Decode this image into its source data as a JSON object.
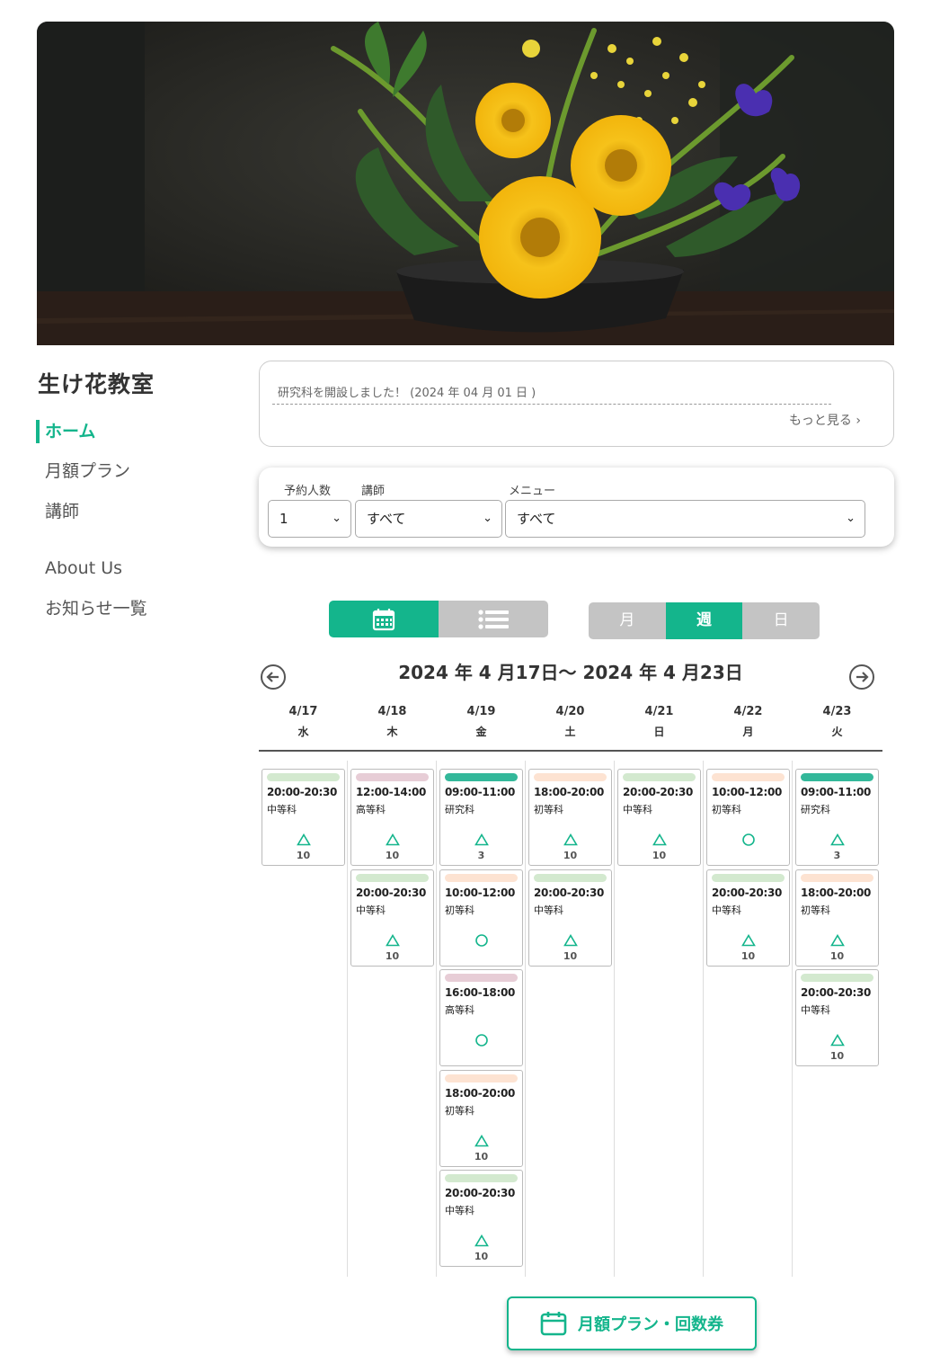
{
  "site": {
    "title": "生け花教室"
  },
  "hero": {
    "image": "ikebana-flower-arrangement"
  },
  "nav": {
    "items": [
      {
        "label": "ホーム",
        "active": true
      },
      {
        "label": "月額プラン"
      },
      {
        "label": "講師"
      },
      {
        "label": "About Us"
      },
      {
        "label": "お知らせ一覧"
      }
    ]
  },
  "news": {
    "item": "研究科を開設しました！ (2024 年 04 月 01 日 )",
    "more": "もっと見る"
  },
  "filters": {
    "people": {
      "label": "予約人数",
      "value": "1"
    },
    "teacher": {
      "label": "講師",
      "value": "すべて"
    },
    "menu": {
      "label": "メニュー",
      "value": "すべて"
    }
  },
  "view_toggle": {
    "icons": [
      "calendar-icon",
      "list-icon"
    ],
    "selected": "calendar"
  },
  "range_toggle": {
    "month": "月",
    "week": "週",
    "day": "日",
    "selected": "週"
  },
  "calendar": {
    "range": "2024 年 4 月17日〜 2024 年 4 月23日",
    "days": [
      {
        "date": "4/17",
        "weekday": "水"
      },
      {
        "date": "4/18",
        "weekday": "木"
      },
      {
        "date": "4/19",
        "weekday": "金"
      },
      {
        "date": "4/20",
        "weekday": "土"
      },
      {
        "date": "4/21",
        "weekday": "日"
      },
      {
        "date": "4/22",
        "weekday": "月"
      },
      {
        "date": "4/23",
        "weekday": "火"
      }
    ],
    "slots": [
      [
        {
          "time": "20:00-20:30",
          "menu": "中等科",
          "status": "△",
          "remaining": "10",
          "color": "#d3e9cf"
        }
      ],
      [
        {
          "time": "12:00-14:00",
          "menu": "高等科",
          "status": "△",
          "remaining": "10",
          "color": "#e7cdd6"
        },
        {
          "time": "20:00-20:30",
          "menu": "中等科",
          "status": "△",
          "remaining": "10",
          "color": "#d3e9cf"
        }
      ],
      [
        {
          "time": "09:00-11:00",
          "menu": "研究科",
          "status": "△",
          "remaining": "3",
          "color": "#33b89a"
        },
        {
          "time": "10:00-12:00",
          "menu": "初等科",
          "status": "○",
          "remaining": "",
          "color": "#fde3d2"
        },
        {
          "time": "16:00-18:00",
          "menu": "高等科",
          "status": "○",
          "remaining": "",
          "color": "#e7cdd6"
        },
        {
          "time": "18:00-20:00",
          "menu": "初等科",
          "status": "△",
          "remaining": "10",
          "color": "#fde3d2"
        },
        {
          "time": "20:00-20:30",
          "menu": "中等科",
          "status": "△",
          "remaining": "10",
          "color": "#d3e9cf"
        }
      ],
      [
        {
          "time": "18:00-20:00",
          "menu": "初等科",
          "status": "△",
          "remaining": "10",
          "color": "#fde3d2"
        },
        {
          "time": "20:00-20:30",
          "menu": "中等科",
          "status": "△",
          "remaining": "10",
          "color": "#d3e9cf"
        }
      ],
      [
        {
          "time": "20:00-20:30",
          "menu": "中等科",
          "status": "△",
          "remaining": "10",
          "color": "#d3e9cf"
        }
      ],
      [
        {
          "time": "10:00-12:00",
          "menu": "初等科",
          "status": "○",
          "remaining": "",
          "color": "#fde3d2"
        },
        {
          "time": "20:00-20:30",
          "menu": "中等科",
          "status": "△",
          "remaining": "10",
          "color": "#d3e9cf"
        }
      ],
      [
        {
          "time": "09:00-11:00",
          "menu": "研究科",
          "status": "△",
          "remaining": "3",
          "color": "#33b89a"
        },
        {
          "time": "18:00-20:00",
          "menu": "初等科",
          "status": "△",
          "remaining": "10",
          "color": "#fde3d2"
        },
        {
          "time": "20:00-20:30",
          "menu": "中等科",
          "status": "△",
          "remaining": "10",
          "color": "#d3e9cf"
        }
      ]
    ]
  },
  "cta": {
    "label": "月額プラン・回数券"
  },
  "colors": {
    "accent": "#14b58c",
    "toggle_inactive": "#c4c4c4"
  }
}
